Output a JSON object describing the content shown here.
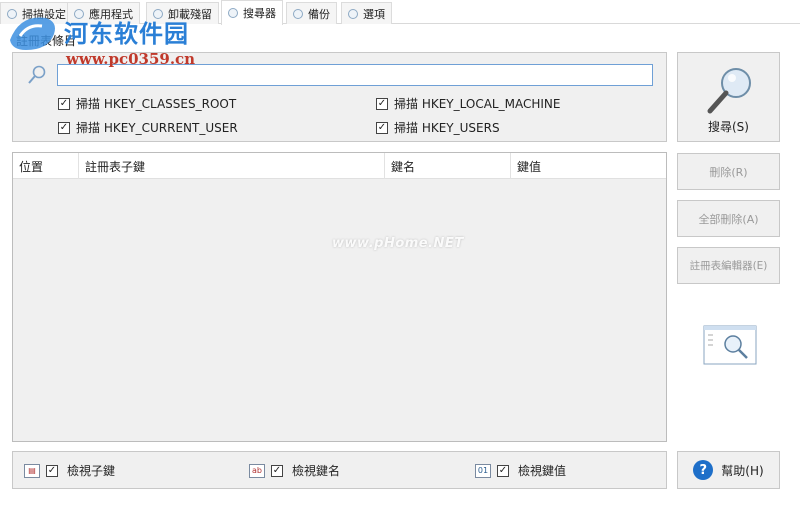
{
  "tabs": [
    {
      "label": "掃描設定",
      "active": false
    },
    {
      "label": "應用程式",
      "active": false
    },
    {
      "label": "卸載殘留",
      "active": false
    },
    {
      "label": "搜尋器",
      "active": true
    },
    {
      "label": "備份",
      "active": false
    },
    {
      "label": "選項",
      "active": false
    }
  ],
  "watermark_logo": {
    "title": "河东软件园",
    "url": "www.pc0359.cn"
  },
  "search_group": {
    "label": "註冊表條目",
    "input_value": "",
    "checkboxes": {
      "classes_root": {
        "label": "掃描 HKEY_CLASSES_ROOT",
        "checked": true
      },
      "local_machine": {
        "label": "掃描 HKEY_LOCAL_MACHINE",
        "checked": true
      },
      "current_user": {
        "label": "掃描 HKEY_CURRENT_USER",
        "checked": true
      },
      "users": {
        "label": "掃描 HKEY_USERS",
        "checked": true
      }
    }
  },
  "results_table": {
    "columns": [
      "位置",
      "註冊表子鍵",
      "鍵名",
      "鍵值"
    ],
    "rows": [],
    "watermark": "www.pHome.NET"
  },
  "side_buttons": {
    "search": "搜尋(S)",
    "delete": "刪除(R)",
    "delete_all": "全部刪除(A)",
    "regedit": "註冊表編輯器(E)"
  },
  "bottom_bar": {
    "view_subkey": {
      "label": "檢視子鍵",
      "checked": true
    },
    "view_keyname": {
      "label": "檢視鍵名",
      "checked": true
    },
    "view_keyvalue": {
      "label": "檢視鍵值",
      "checked": true
    }
  },
  "help_button": "幫助(H)",
  "colors": {
    "accent": "#1e6fc9",
    "input_border": "#6fa0d6",
    "panel_bg": "#f0f0f0"
  }
}
